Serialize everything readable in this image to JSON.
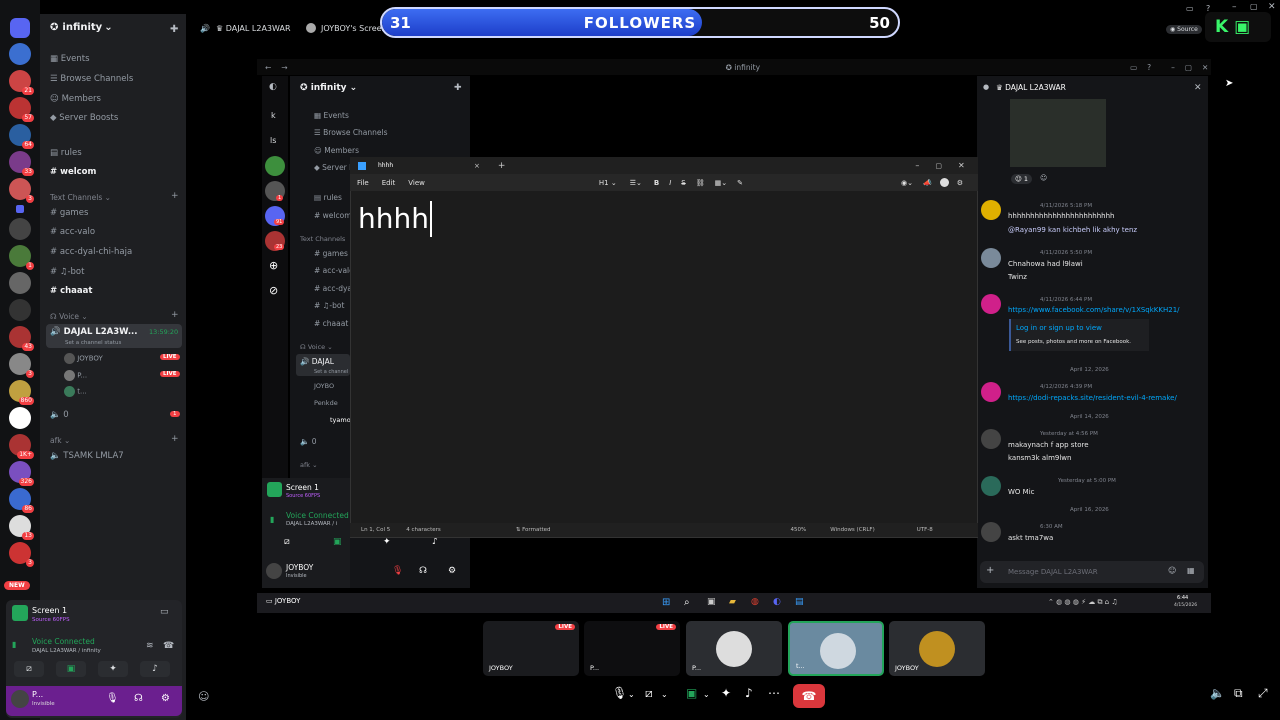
{
  "guild": {
    "name": "infinity"
  },
  "top_tabs": {
    "voice": "DAJAL L2A3WAR",
    "screen": "JOYBOY's Screen"
  },
  "source_badge": "Source",
  "followers": {
    "current": "31",
    "label": "FOLLOWERS",
    "goal": "50",
    "fraction": 0.62
  },
  "k_badge": "K",
  "rail_badges": [
    "21",
    "57",
    "64",
    "33",
    "3",
    "1",
    "43",
    "3",
    "860",
    "1K+",
    "326",
    "86",
    "13",
    "3"
  ],
  "new_badge": "NEW",
  "nav": {
    "events": "Events",
    "browse": "Browse Channels",
    "members": "Members",
    "boosts": "Server Boosts"
  },
  "channels": {
    "rules": "rules",
    "welcom": "welcom",
    "text_cat": "Text Channels",
    "games": "games",
    "acc_valo": "acc-valo",
    "acc_dyal": "acc-dyal-chi-haja",
    "bot": "-bot",
    "chaaat": "chaaat",
    "voice_cat": "Voice",
    "voice_ch": "DAJAL L2A3W...",
    "voice_time": "13:59:20",
    "set_status": "Set a channel status",
    "m1": "JOYBOY",
    "m2": "P...",
    "m3": "t...",
    "live": "LIVE",
    "zero": "0",
    "zero_badge": "1",
    "afk_cat": "afk",
    "afk_ch": "TSAMK LMLA7"
  },
  "panel": {
    "screen": "Screen 1",
    "source": "Source 60FPS",
    "connected": "Voice Connected",
    "conn_sub": "DAJAL L2A3WAR / infinity",
    "user": "P...",
    "status": "Invisible"
  },
  "inner": {
    "title": "infinity",
    "guild": "infinity",
    "events": "Events",
    "browse": "Browse Channels",
    "members": "Members",
    "boosts": "Server Bo...",
    "rules": "rules",
    "welcom": "welcom",
    "text_cat": "Text Channels",
    "games": "games",
    "acc_valo": "acc-valo",
    "acc_dyal": "acc-dyal-c",
    "bot": "-bot",
    "chaaat": "chaaat",
    "voice_cat": "Voice",
    "voice_ch": "DAJAL",
    "set": "Set a channel",
    "m1": "JOYBO",
    "m2": "Penkde",
    "m3": "tyamo",
    "zero": "0",
    "afk": "afk",
    "screen": "Screen 1",
    "source": "Source 60FPS",
    "connected": "Voice Connected",
    "conn_sub": "DAJAL L2A3WAR / i",
    "user": "JOYBOY",
    "status": "Invisible",
    "rail_k": "k",
    "rail_ls": "ls",
    "rail_b1": "1",
    "rail_b2": "91",
    "rail_b3": "23"
  },
  "dm": {
    "title": "DAJAL L2A3WAR",
    "react": "1",
    "composer": "Message DAJAL L2A3WAR",
    "messages": [
      {
        "meta": "4/11/2026 5:18 PM",
        "line1": "hhhhhhhhhhhhhhhhhhhhhhhh",
        "line2": "@Rayan99 kan kichbeh lik akhy tenz"
      },
      {
        "meta": "4/11/2026 5:50 PM",
        "line1": "Chnahowa had l9lawi",
        "line2": "Twinz"
      },
      {
        "meta": "4/11/2026 6:44 PM",
        "line1": "https://www.facebook.com/share/v/1XSqkKKH21/",
        "line2": "Log in or sign up to view",
        "line3": "See posts, photos and more on Facebook."
      },
      {
        "meta": "4/12/2026 4:39 PM",
        "line1": "https://dodi-repacks.site/resident-evil-4-remake/"
      },
      {
        "meta": "Yesterday at 4:56 PM",
        "line1": "makaynach f app store",
        "line2": "kansm3k alm9lwn"
      },
      {
        "meta": "Yesterday at 5:00 PM",
        "line1": "WO Mic"
      },
      {
        "meta": "6:30 AM",
        "line1": "askt tma7wa"
      }
    ],
    "dates": [
      "April 12, 2026",
      "April 14, 2026",
      "April 16, 2026"
    ]
  },
  "notepad": {
    "tab": "hhhh",
    "menu_file": "File",
    "menu_edit": "Edit",
    "menu_view": "View",
    "heading": "H1",
    "content": "hhhh",
    "pos": "Ln 1, Col 5",
    "chars": "4 characters",
    "mode": "Formatted",
    "zoom": "450%",
    "eol": "Windows (CRLF)",
    "enc": "UTF-8"
  },
  "inner_task": {
    "user": "JOYBOY",
    "time": "6:44",
    "date": "4/15/2026"
  },
  "thumbs": [
    {
      "label": "JOYBOY",
      "live": "LIVE"
    },
    {
      "label": "P...",
      "live": "LIVE"
    },
    {
      "label": "P..."
    },
    {
      "label": "t..."
    },
    {
      "label": "JOYBOY"
    }
  ]
}
